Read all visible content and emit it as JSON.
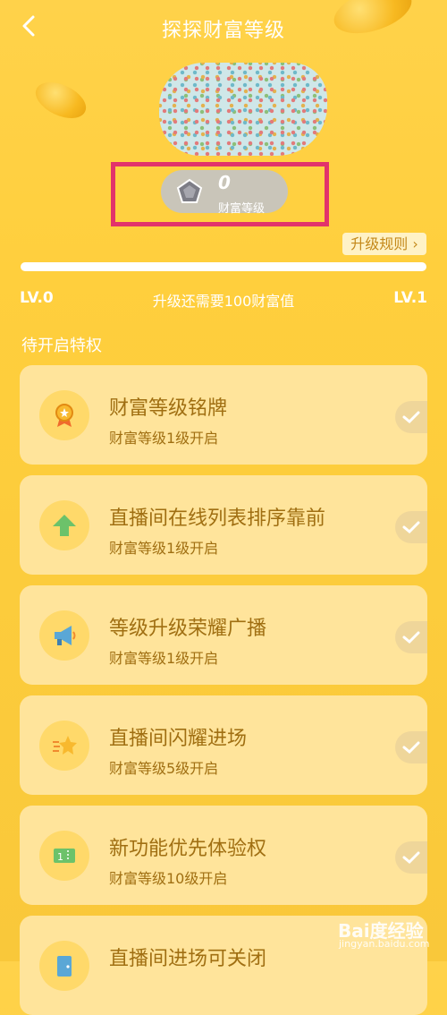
{
  "header": {
    "title": "探探财富等级"
  },
  "wealth": {
    "level_value": "0",
    "caption": "财富等级"
  },
  "rules_button": {
    "label": "升级规则 ›"
  },
  "progress": {
    "fraction": 0,
    "left_label": "LV.0",
    "right_label": "LV.1",
    "need_text": "升级还需要100财富值"
  },
  "privileges": {
    "section_title": "待开启特权",
    "items": [
      {
        "name": "财富等级铭牌",
        "requirement": "财富等级1级开启",
        "icon": "medal-icon"
      },
      {
        "name": "直播间在线列表排序靠前",
        "requirement": "财富等级1级开启",
        "icon": "arrow-up-icon"
      },
      {
        "name": "等级升级荣耀广播",
        "requirement": "财富等级1级开启",
        "icon": "megaphone-icon"
      },
      {
        "name": "直播间闪耀进场",
        "requirement": "财富等级5级开启",
        "icon": "shooting-star-icon"
      },
      {
        "name": "新功能优先体验权",
        "requirement": "财富等级10级开启",
        "icon": "ticket-icon"
      },
      {
        "name": "直播间进场可关闭",
        "requirement": "",
        "icon": "door-icon"
      }
    ]
  },
  "colors": {
    "background": "#ffcf3d",
    "card": "#ffe49b",
    "text": "#a06f12",
    "highlight": "#e2336b"
  },
  "watermark": {
    "text": "Bai度经验",
    "sub": "jingyan.baidu.com"
  }
}
